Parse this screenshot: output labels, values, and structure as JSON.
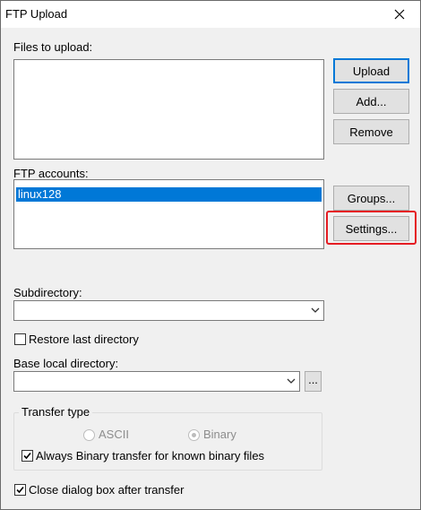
{
  "window": {
    "title": "FTP Upload"
  },
  "files": {
    "label": "Files to upload:",
    "items": []
  },
  "accounts": {
    "label": "FTP accounts:",
    "items": [
      "linux128"
    ],
    "selected": "linux128"
  },
  "buttons": {
    "upload": "Upload",
    "add": "Add...",
    "remove": "Remove",
    "groups": "Groups...",
    "settings": "Settings...",
    "browse": "..."
  },
  "subdirectory": {
    "label": "Subdirectory:",
    "value": ""
  },
  "restore_last_directory": {
    "label": "Restore last directory",
    "checked": false
  },
  "base_local_directory": {
    "label": "Base local directory:",
    "value": ""
  },
  "transfer_type": {
    "legend": "Transfer type",
    "options": [
      "ASCII",
      "Binary"
    ],
    "selected": "Binary",
    "enabled": false
  },
  "always_binary": {
    "label": "Always Binary transfer for known binary files",
    "checked": true
  },
  "close_after_transfer": {
    "label": "Close dialog box after transfer",
    "checked": true
  },
  "highlight_color": "#e51c23",
  "accent_color": "#0078d7"
}
